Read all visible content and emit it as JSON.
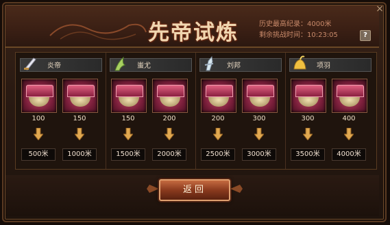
{
  "title": "先帝试炼",
  "record": {
    "best_label": "历史最高纪录：4000米",
    "remaining_label": "剩余挑战时间：10:23:05"
  },
  "help_label": "?",
  "close_label": "×",
  "groups": [
    {
      "hero": "炎帝",
      "icon": "sword-icon",
      "chests": [
        {
          "value": "100",
          "distance": "500米"
        },
        {
          "value": "150",
          "distance": "1000米"
        }
      ]
    },
    {
      "hero": "蚩尤",
      "icon": "claw-icon",
      "chests": [
        {
          "value": "150",
          "distance": "1500米"
        },
        {
          "value": "200",
          "distance": "2000米"
        }
      ]
    },
    {
      "hero": "刘邦",
      "icon": "blade-icon",
      "chests": [
        {
          "value": "200",
          "distance": "2500米"
        },
        {
          "value": "300",
          "distance": "3000米"
        }
      ]
    },
    {
      "hero": "项羽",
      "icon": "helmet-icon",
      "chests": [
        {
          "value": "300",
          "distance": "3500米"
        },
        {
          "value": "400",
          "distance": "4000米"
        }
      ]
    }
  ],
  "back_button": "返回"
}
